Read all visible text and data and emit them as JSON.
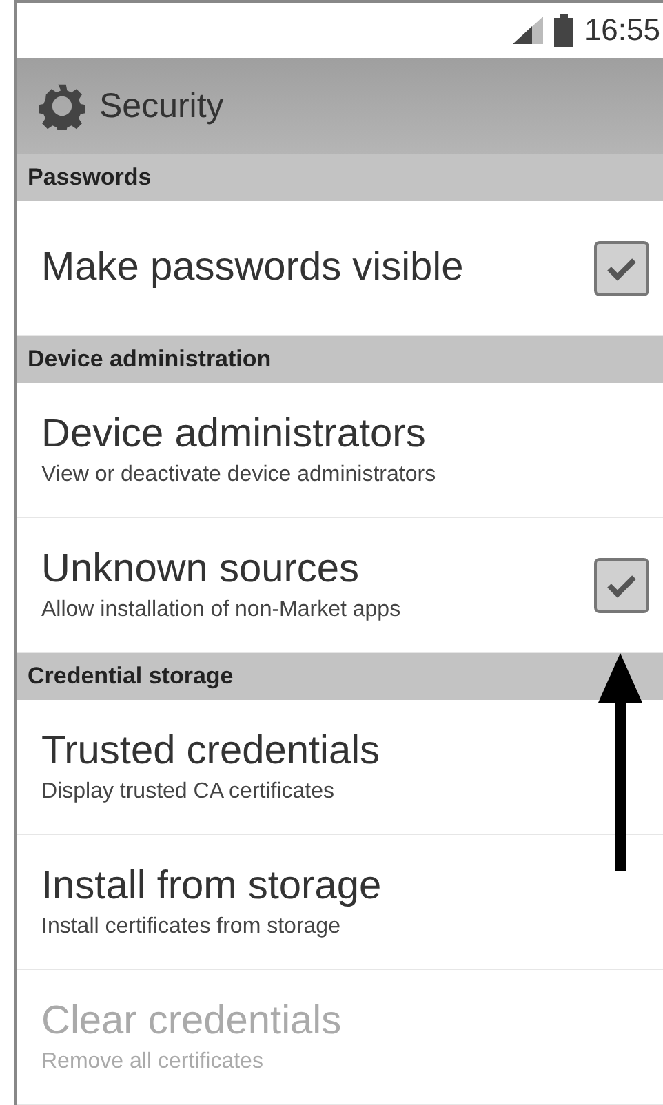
{
  "status_bar": {
    "time": "16:55"
  },
  "header": {
    "title": "Security"
  },
  "sections": [
    {
      "title": "Passwords",
      "items": [
        {
          "kind": "check",
          "title": "Make passwords visible",
          "checked": true,
          "disabled": false
        }
      ]
    },
    {
      "title": "Device administration",
      "items": [
        {
          "kind": "plain",
          "title": "Device administrators",
          "summary": "View or deactivate device administrators",
          "disabled": false
        },
        {
          "kind": "check",
          "title": "Unknown sources",
          "summary": "Allow installation of non-Market apps",
          "checked": true,
          "disabled": false
        }
      ]
    },
    {
      "title": "Credential storage",
      "items": [
        {
          "kind": "plain",
          "title": "Trusted credentials",
          "summary": "Display trusted CA certificates",
          "disabled": false
        },
        {
          "kind": "plain",
          "title": "Install from storage",
          "summary": "Install certificates from storage",
          "disabled": false
        },
        {
          "kind": "plain",
          "title": "Clear credentials",
          "summary": "Remove all certificates",
          "disabled": true
        }
      ]
    }
  ]
}
